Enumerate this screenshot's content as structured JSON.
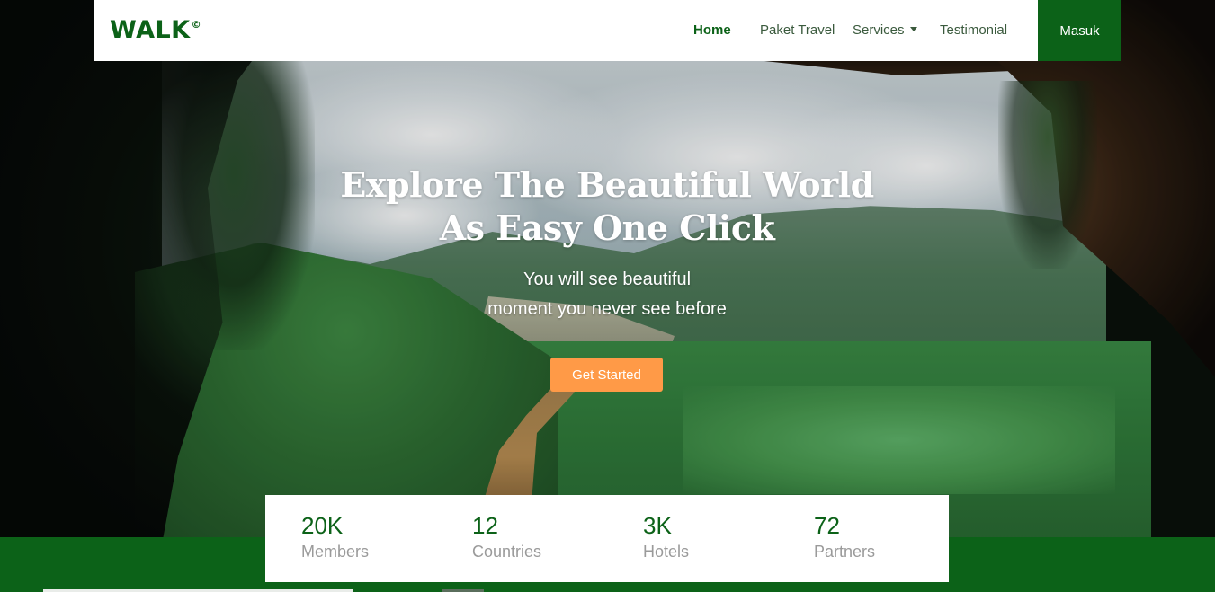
{
  "brand": {
    "name": "WALK",
    "mark": "©"
  },
  "nav": {
    "home": "Home",
    "paket": "Paket Travel",
    "services": "Services",
    "testimonial": "Testimonial",
    "login": "Masuk"
  },
  "hero": {
    "title_line1": "Explore The Beautiful World",
    "title_line2": "As Easy One Click",
    "subtitle_line1": "You will see beautiful",
    "subtitle_line2": "moment you never see before",
    "cta": "Get Started"
  },
  "stats": [
    {
      "value": "20K",
      "label": "Members"
    },
    {
      "value": "12",
      "label": "Countries"
    },
    {
      "value": "3K",
      "label": "Hotels"
    },
    {
      "value": "72",
      "label": "Partners"
    }
  ],
  "colors": {
    "brand_green": "#0c6218",
    "cta_orange": "#ff9a47",
    "muted_text": "#9a9a9a"
  },
  "icons": {
    "dropdown": "caret-down-icon"
  }
}
